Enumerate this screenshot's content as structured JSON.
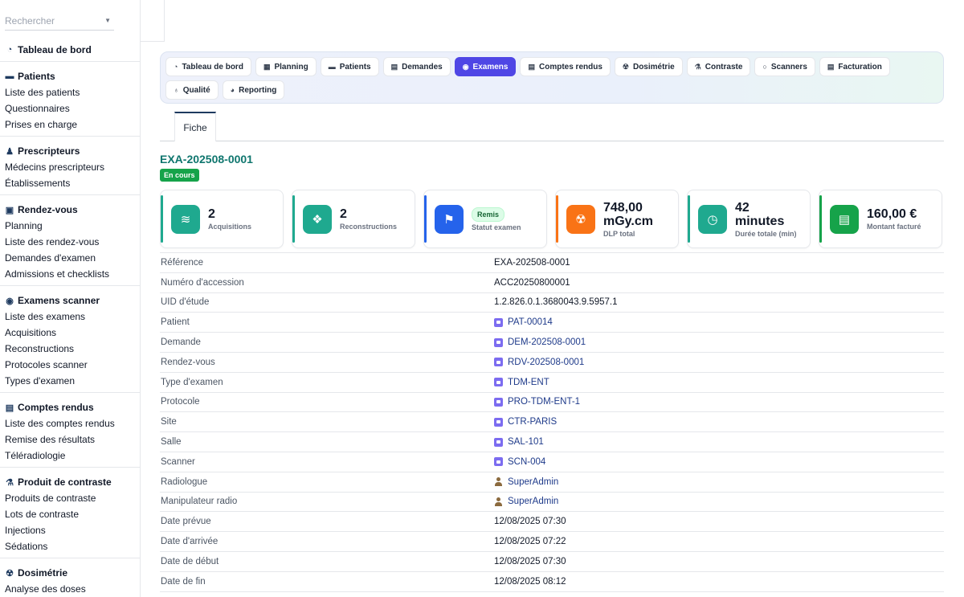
{
  "sidebar": {
    "search_placeholder": "Rechercher",
    "dashboard": "Tableau de bord",
    "sections": [
      {
        "title": "Patients",
        "icon": "bed-icon",
        "items": [
          "Liste des patients",
          "Questionnaires",
          "Prises en charge"
        ]
      },
      {
        "title": "Prescripteurs",
        "icon": "user-md-icon",
        "items": [
          "Médecins prescripteurs",
          "Établissements"
        ]
      },
      {
        "title": "Rendez-vous",
        "icon": "calendar-check-icon",
        "items": [
          "Planning",
          "Liste des rendez-vous",
          "Demandes d'examen",
          "Admissions et checklists"
        ]
      },
      {
        "title": "Examens scanner",
        "icon": "disc-icon",
        "items": [
          "Liste des examens",
          "Acquisitions",
          "Reconstructions",
          "Protocoles scanner",
          "Types d'examen"
        ]
      },
      {
        "title": "Comptes rendus",
        "icon": "file-icon",
        "items": [
          "Liste des comptes rendus",
          "Remise des résultats",
          "Téléradiologie"
        ]
      },
      {
        "title": "Produit de contraste",
        "icon": "flask-icon",
        "items": [
          "Produits de contraste",
          "Lots de contraste",
          "Injections",
          "Sédations"
        ]
      },
      {
        "title": "Dosimétrie",
        "icon": "radiation-icon",
        "items": [
          "Analyse des doses"
        ]
      }
    ]
  },
  "tabs": [
    {
      "label": "Tableau de bord",
      "icon": "gauge-icon",
      "active": false
    },
    {
      "label": "Planning",
      "icon": "calendar-icon",
      "active": false
    },
    {
      "label": "Patients",
      "icon": "bed-icon",
      "active": false
    },
    {
      "label": "Demandes",
      "icon": "file-icon",
      "active": false
    },
    {
      "label": "Examens",
      "icon": "disc-icon",
      "active": true
    },
    {
      "label": "Comptes rendus",
      "icon": "document-icon",
      "active": false
    },
    {
      "label": "Dosimétrie",
      "icon": "radiation-icon",
      "active": false
    },
    {
      "label": "Contraste",
      "icon": "flask-icon",
      "active": false
    },
    {
      "label": "Scanners",
      "icon": "circle-icon",
      "active": false
    },
    {
      "label": "Facturation",
      "icon": "invoice-icon",
      "active": false
    },
    {
      "label": "Qualité",
      "icon": "award-icon",
      "active": false
    },
    {
      "label": "Reporting",
      "icon": "chart-pie-icon",
      "active": false
    }
  ],
  "subtab": "Fiche",
  "exam": {
    "id": "EXA-202508-0001",
    "status": "En cours"
  },
  "cards": [
    {
      "value": "2",
      "label": "Acquisitions",
      "icon": "layers-icon",
      "color": "#1fa98f",
      "bar": "#1fa98f"
    },
    {
      "value": "2",
      "label": "Reconstructions",
      "icon": "cubes-icon",
      "color": "#1fa98f",
      "bar": "#1fa98f"
    },
    {
      "pill": "Remis",
      "label": "Statut examen",
      "icon": "flag-icon",
      "color": "#2563eb",
      "bar": "#2563eb"
    },
    {
      "value": "748,00 mGy.cm",
      "label": "DLP total",
      "icon": "radiation-icon",
      "color": "#f97316",
      "bar": "#f97316"
    },
    {
      "value": "42 minutes",
      "label": "Durée totale (min)",
      "icon": "clock-icon",
      "color": "#1fa98f",
      "bar": "#1fa98f"
    },
    {
      "value": "160,00 €",
      "label": "Montant facturé",
      "icon": "invoice-icon",
      "color": "#16a34a",
      "bar": "#16a34a"
    }
  ],
  "fields": [
    {
      "key": "Référence",
      "value": "EXA-202508-0001",
      "kind": "text"
    },
    {
      "key": "Numéro d'accession",
      "value": "ACC20250800001",
      "kind": "text"
    },
    {
      "key": "UID d'étude",
      "value": "1.2.826.0.1.3680043.9.5957.1",
      "kind": "text"
    },
    {
      "key": "Patient",
      "value": "PAT-00014",
      "kind": "link"
    },
    {
      "key": "Demande",
      "value": "DEM-202508-0001",
      "kind": "link"
    },
    {
      "key": "Rendez-vous",
      "value": "RDV-202508-0001",
      "kind": "link"
    },
    {
      "key": "Type d'examen",
      "value": "TDM-ENT",
      "kind": "link"
    },
    {
      "key": "Protocole",
      "value": "PRO-TDM-ENT-1",
      "kind": "link"
    },
    {
      "key": "Site",
      "value": "CTR-PARIS",
      "kind": "link"
    },
    {
      "key": "Salle",
      "value": "SAL-101",
      "kind": "link"
    },
    {
      "key": "Scanner",
      "value": "SCN-004",
      "kind": "link"
    },
    {
      "key": "Radiologue",
      "value": "SuperAdmin",
      "kind": "user"
    },
    {
      "key": "Manipulateur radio",
      "value": "SuperAdmin",
      "kind": "user"
    },
    {
      "key": "Date prévue",
      "value": "12/08/2025 07:30",
      "kind": "text"
    },
    {
      "key": "Date d'arrivée",
      "value": "12/08/2025 07:22",
      "kind": "text"
    },
    {
      "key": "Date de début",
      "value": "12/08/2025 07:30",
      "kind": "text"
    },
    {
      "key": "Date de fin",
      "value": "12/08/2025 08:12",
      "kind": "text"
    }
  ]
}
